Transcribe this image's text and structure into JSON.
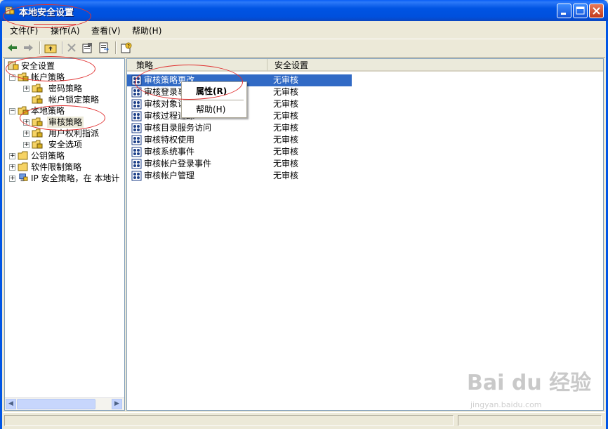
{
  "window": {
    "title": "本地安全设置"
  },
  "menu": [
    "文件(F)",
    "操作(A)",
    "查看(V)",
    "帮助(H)"
  ],
  "toolbar": [
    "back-icon",
    "forward-icon",
    "up-folder-icon",
    "delete-icon",
    "properties-icon",
    "export-list-icon",
    "help-icon"
  ],
  "tree": {
    "root": "安全设置",
    "nodes": [
      {
        "label": "帐户策略"
      },
      {
        "label": "密码策略"
      },
      {
        "label": "帐户锁定策略"
      },
      {
        "label": "本地策略"
      },
      {
        "label": "审核策略"
      },
      {
        "label": "用户权利指派"
      },
      {
        "label": "安全选项"
      },
      {
        "label": "公钥策略"
      },
      {
        "label": "软件限制策略"
      },
      {
        "label": "IP 安全策略，在 本地计"
      }
    ]
  },
  "list": {
    "columns": [
      "策略",
      "安全设置"
    ],
    "rows": [
      {
        "name": "审核策略更改",
        "value": "无审核"
      },
      {
        "name": "审核登录事",
        "value": "无审核"
      },
      {
        "name": "审核对象访",
        "value": "无审核"
      },
      {
        "name": "审核过程追踪",
        "value": "无审核"
      },
      {
        "name": "审核目录服务访问",
        "value": "无审核"
      },
      {
        "name": "审核特权使用",
        "value": "无审核"
      },
      {
        "name": "审核系统事件",
        "value": "无审核"
      },
      {
        "name": "审核帐户登录事件",
        "value": "无审核"
      },
      {
        "name": "审核帐户管理",
        "value": "无审核"
      }
    ]
  },
  "context_menu": {
    "properties": "属性(R)",
    "help": "帮助(H)"
  },
  "watermark": {
    "brand": "Bai du 经验",
    "url": "jingyan.baidu.com"
  },
  "colors": {
    "titlebar": "#0054E3",
    "selection": "#316AC5",
    "annotation": "#E03030"
  }
}
